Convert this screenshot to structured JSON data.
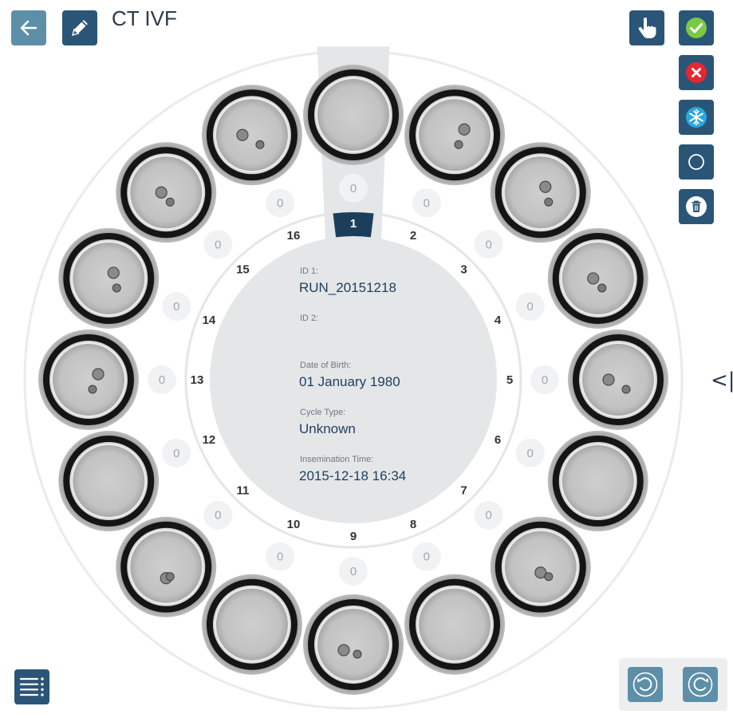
{
  "header": {
    "title": "CT IVF"
  },
  "toolbar": {
    "back_icon": "arrow-left-icon",
    "edit_icon": "pencil-icon",
    "select_icon": "hand-pointer-icon",
    "accept_icon": "check-icon",
    "reject_icon": "cross-icon",
    "freeze_icon": "snowflake-icon",
    "unmark_icon": "circle-icon",
    "delete_icon": "trash-icon",
    "menu_icon": "list-menu-icon",
    "rotate_ccw_icon": "rotate-ccw-icon",
    "rotate_cw_icon": "rotate-cw-icon"
  },
  "colors": {
    "button": "#2b5577",
    "back_button": "#5d8fa9",
    "accept": "#7ac943",
    "reject": "#e8262f",
    "freeze": "#2aa7e0",
    "selected_sector": "#1d3e5b"
  },
  "dish": {
    "selected_well": 1,
    "wells": [
      {
        "number": "1",
        "score": "0"
      },
      {
        "number": "2",
        "score": "0"
      },
      {
        "number": "3",
        "score": "0"
      },
      {
        "number": "4",
        "score": "0"
      },
      {
        "number": "5",
        "score": "0"
      },
      {
        "number": "6",
        "score": "0"
      },
      {
        "number": "7",
        "score": "0"
      },
      {
        "number": "8",
        "score": "0"
      },
      {
        "number": "9",
        "score": "0"
      },
      {
        "number": "10",
        "score": "0"
      },
      {
        "number": "11",
        "score": "0"
      },
      {
        "number": "12",
        "score": "0"
      },
      {
        "number": "13",
        "score": "0"
      },
      {
        "number": "14",
        "score": "0"
      },
      {
        "number": "15",
        "score": "0"
      },
      {
        "number": "16",
        "score": "0"
      }
    ]
  },
  "patient": {
    "id1_label": "ID 1:",
    "id1_value": "RUN_20151218",
    "id2_label": "ID 2:",
    "id2_value": "",
    "dob_label": "Date of Birth:",
    "dob_value": "01 January 1980",
    "cycle_label": "Cycle Type:",
    "cycle_value": "Unknown",
    "insem_label": "Insemination Time:",
    "insem_value": "2015-12-18 16:34"
  },
  "side_panel": {
    "collapse_label": "<|"
  }
}
